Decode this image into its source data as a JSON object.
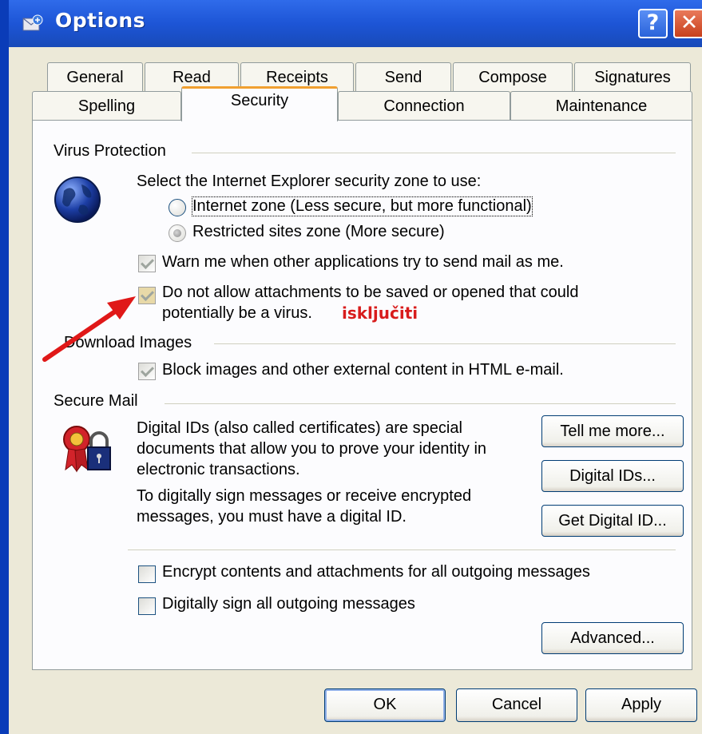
{
  "window": {
    "title": "Options",
    "help_label": "?",
    "close_label": "✕"
  },
  "tabs_row_back": [
    {
      "label": "General"
    },
    {
      "label": "Read"
    },
    {
      "label": "Receipts"
    },
    {
      "label": "Send"
    },
    {
      "label": "Compose"
    },
    {
      "label": "Signatures"
    }
  ],
  "tabs_row_front": [
    {
      "label": "Spelling"
    },
    {
      "label": "Security",
      "active": true
    },
    {
      "label": "Connection"
    },
    {
      "label": "Maintenance"
    }
  ],
  "virus_protection": {
    "group_label": "Virus Protection",
    "icon": "globe-icon",
    "zone_prompt": "Select the Internet Explorer security zone to use:",
    "zones": [
      {
        "label": "Internet zone (Less secure, but more functional)",
        "selected": false
      },
      {
        "label": "Restricted sites zone (More secure)",
        "selected": true
      }
    ],
    "warn_label": "Warn me when other applications try to send mail as me.",
    "warn_checked": true,
    "attachments_label_line1": "Do not allow attachments to be saved or opened that could",
    "attachments_label_line2": "potentially be a virus.",
    "attachments_checked": true
  },
  "annotation": {
    "text": "isključiti",
    "color": "#d81c1c",
    "arrow": "red-arrow"
  },
  "download_images": {
    "group_label": "Download Images",
    "block_label": "Block images and other external content in HTML e-mail.",
    "block_checked": true
  },
  "secure_mail": {
    "group_label": "Secure Mail",
    "icon": "certificate-lock-icon",
    "desc_lines": [
      "Digital IDs (also called certificates) are special",
      "documents that allow you to prove your identity in",
      "electronic transactions."
    ],
    "sign_lines": [
      "To digitally sign messages or receive encrypted",
      "messages, you must have a digital ID."
    ],
    "tell_me_more": "Tell me more...",
    "digital_ids": "Digital IDs...",
    "get_digital_id": "Get Digital ID...",
    "encrypt_label": "Encrypt contents and attachments for all outgoing messages",
    "encrypt_checked": false,
    "sign_label": "Digitally sign all outgoing messages",
    "sign_checked": false,
    "advanced": "Advanced..."
  },
  "footer": {
    "ok": "OK",
    "cancel": "Cancel",
    "apply": "Apply"
  },
  "colors": {
    "titlebar": "#1d55d6",
    "dialog_bg": "#ece9d8",
    "panel_bg": "#fcfcfe",
    "active_tab_accent": "#f1a030"
  }
}
